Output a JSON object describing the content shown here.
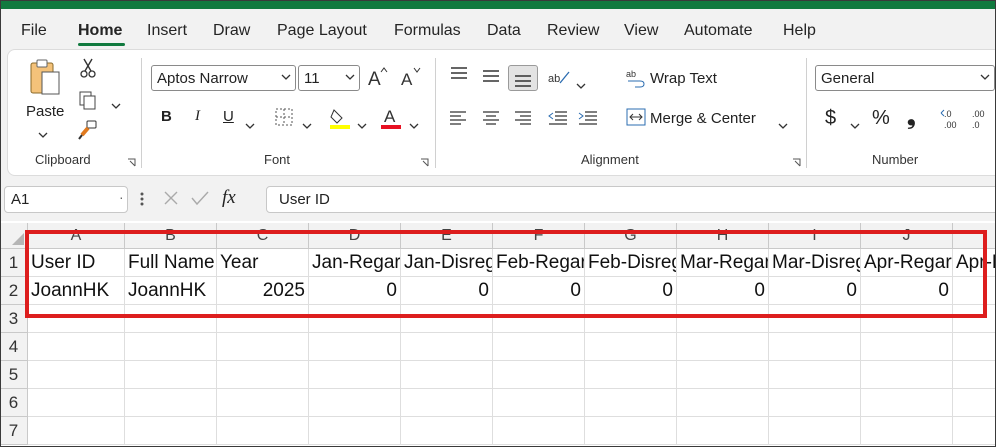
{
  "menu": {
    "items": [
      "File",
      "Home",
      "Insert",
      "Draw",
      "Page Layout",
      "Formulas",
      "Data",
      "Review",
      "View",
      "Automate",
      "Help"
    ],
    "active": "Home"
  },
  "ribbon": {
    "clipboard": {
      "paste_label": "Paste",
      "group_label": "Clipboard"
    },
    "font": {
      "font_name": "Aptos Narrow",
      "font_size": "11",
      "group_label": "Font",
      "highlight_color": "#ffff00",
      "font_color": "#e81123"
    },
    "alignment": {
      "wrap_text": "Wrap Text",
      "merge_center": "Merge & Center",
      "group_label": "Alignment"
    },
    "number": {
      "format": "General",
      "group_label": "Number",
      "currency": "$",
      "percent": "%",
      "comma": "❟"
    }
  },
  "formula_bar": {
    "name_box": "A1",
    "fx": "fx",
    "content": "User ID"
  },
  "sheet": {
    "columns": [
      "A",
      "B",
      "C",
      "D",
      "E",
      "F",
      "G",
      "H",
      "I",
      "J"
    ],
    "rows": [
      "1",
      "2",
      "3",
      "4",
      "5",
      "6",
      "7"
    ],
    "row1": [
      "User ID",
      "Full Name",
      "Year",
      "Jan-Regarded",
      "Jan-Disregarded",
      "Feb-Regarded",
      "Feb-Disregarded",
      "Mar-Regarded",
      "Mar-Disregarded",
      "Apr-Regarded",
      "Apr-D"
    ],
    "row2": [
      "JoannHK",
      "JoannHK",
      "2025",
      "0",
      "0",
      "0",
      "0",
      "0",
      "0",
      "0",
      ""
    ]
  },
  "colors": {
    "excel_green": "#117a3f",
    "highlight_box": "#dd1e1e"
  }
}
